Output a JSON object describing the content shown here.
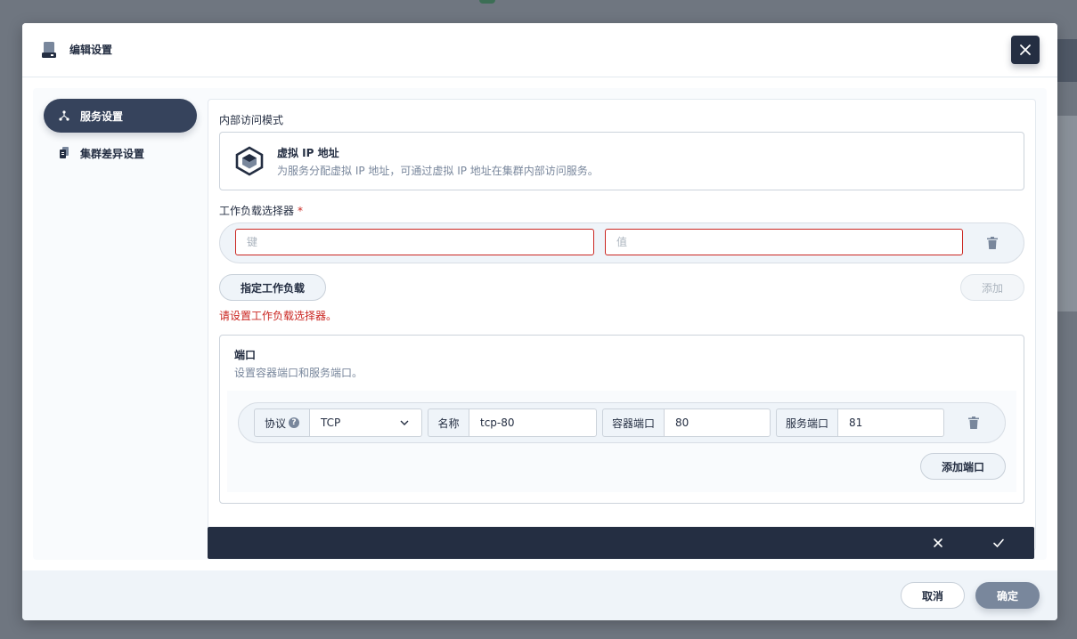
{
  "modal": {
    "title": "编辑设置",
    "close_icon": "close-icon"
  },
  "sidebar": {
    "items": [
      {
        "label": "服务设置",
        "icon": "network-icon",
        "active": true
      },
      {
        "label": "集群差异设置",
        "icon": "documents-icon",
        "active": false
      }
    ]
  },
  "internal_access": {
    "label": "内部访问模式",
    "mode_title": "虚拟 IP 地址",
    "mode_desc": "为服务分配虚拟 IP 地址，可通过虚拟 IP 地址在集群内部访问服务。"
  },
  "selector": {
    "label": "工作负载选择器",
    "required_mark": "*",
    "key_placeholder": "键",
    "value_placeholder": "值",
    "specify_workload_button": "指定工作负载",
    "add_button": "添加",
    "error": "请设置工作负载选择器。"
  },
  "ports": {
    "title": "端口",
    "desc": "设置容器端口和服务端口。",
    "protocol_label": "协议",
    "protocol_help": "?",
    "protocol_value": "TCP",
    "name_label": "名称",
    "name_value": "tcp-80",
    "container_port_label": "容器端口",
    "container_port_value": "80",
    "service_port_label": "服务端口",
    "service_port_value": "81",
    "add_port_button": "添加端口"
  },
  "footer": {
    "cancel": "取消",
    "ok": "确定"
  },
  "colors": {
    "dark": "#242e42",
    "error": "#ca2621",
    "muted": "#79879c",
    "panel": "#eff4f9"
  }
}
